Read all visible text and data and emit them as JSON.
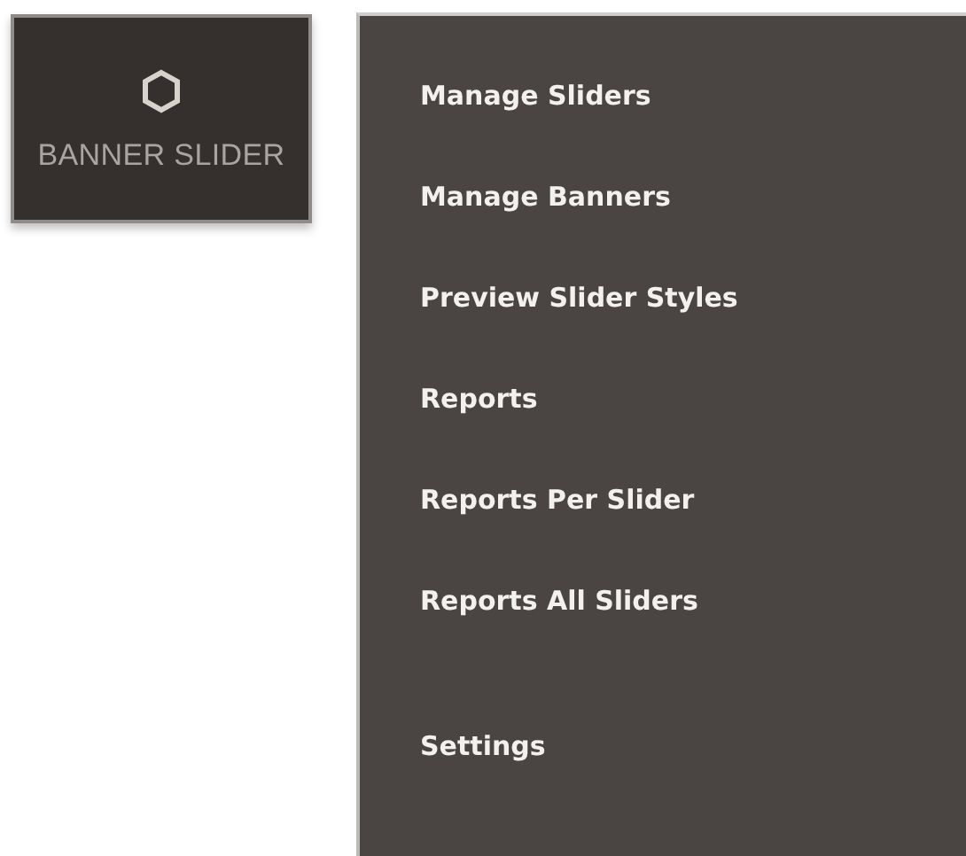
{
  "tile": {
    "label": "BANNER SLIDER"
  },
  "menu": {
    "sections": [
      {
        "items": [
          "Manage Sliders",
          "Manage Banners",
          "Preview Slider Styles",
          "Reports",
          "Reports Per Slider",
          "Reports All Sliders"
        ]
      },
      {
        "items": [
          "Settings"
        ]
      }
    ]
  }
}
